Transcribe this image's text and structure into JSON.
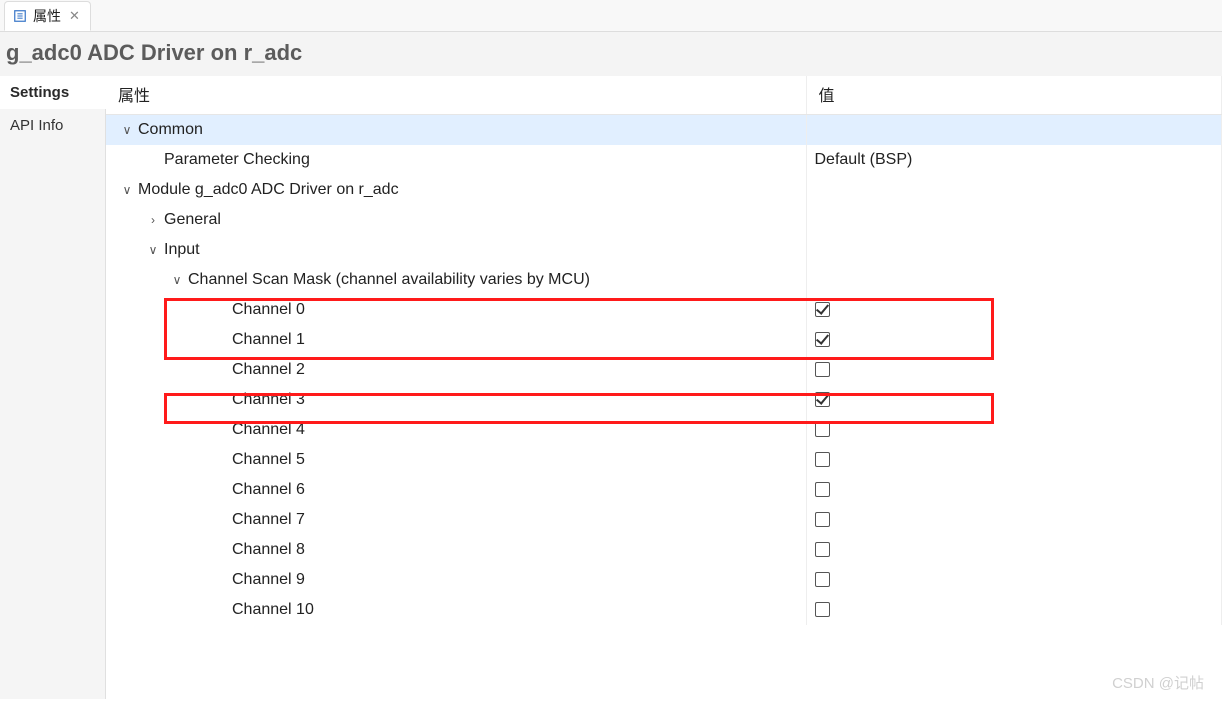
{
  "tab": {
    "label": "属性"
  },
  "title": "g_adc0 ADC Driver on r_adc",
  "sideTabs": [
    "Settings",
    "API Info"
  ],
  "columns": {
    "attr": "属性",
    "value": "值"
  },
  "tree": {
    "common": {
      "label": "Common",
      "children": {
        "paramCheck": {
          "label": "Parameter Checking",
          "value": "Default (BSP)"
        }
      }
    },
    "module": {
      "label": "Module g_adc0 ADC Driver on r_adc",
      "children": {
        "general": {
          "label": "General"
        },
        "input": {
          "label": "Input",
          "children": {
            "scanMask": {
              "label": "Channel Scan Mask (channel availability varies by MCU)",
              "channels": [
                {
                  "label": "Channel 0",
                  "checked": true
                },
                {
                  "label": "Channel 1",
                  "checked": true
                },
                {
                  "label": "Channel 2",
                  "checked": false
                },
                {
                  "label": "Channel 3",
                  "checked": true
                },
                {
                  "label": "Channel 4",
                  "checked": false
                },
                {
                  "label": "Channel 5",
                  "checked": false
                },
                {
                  "label": "Channel 6",
                  "checked": false
                },
                {
                  "label": "Channel 7",
                  "checked": false
                },
                {
                  "label": "Channel 8",
                  "checked": false
                },
                {
                  "label": "Channel 9",
                  "checked": false
                },
                {
                  "label": "Channel 10",
                  "checked": false
                }
              ]
            }
          }
        }
      }
    }
  },
  "watermark": "CSDN @记帖"
}
